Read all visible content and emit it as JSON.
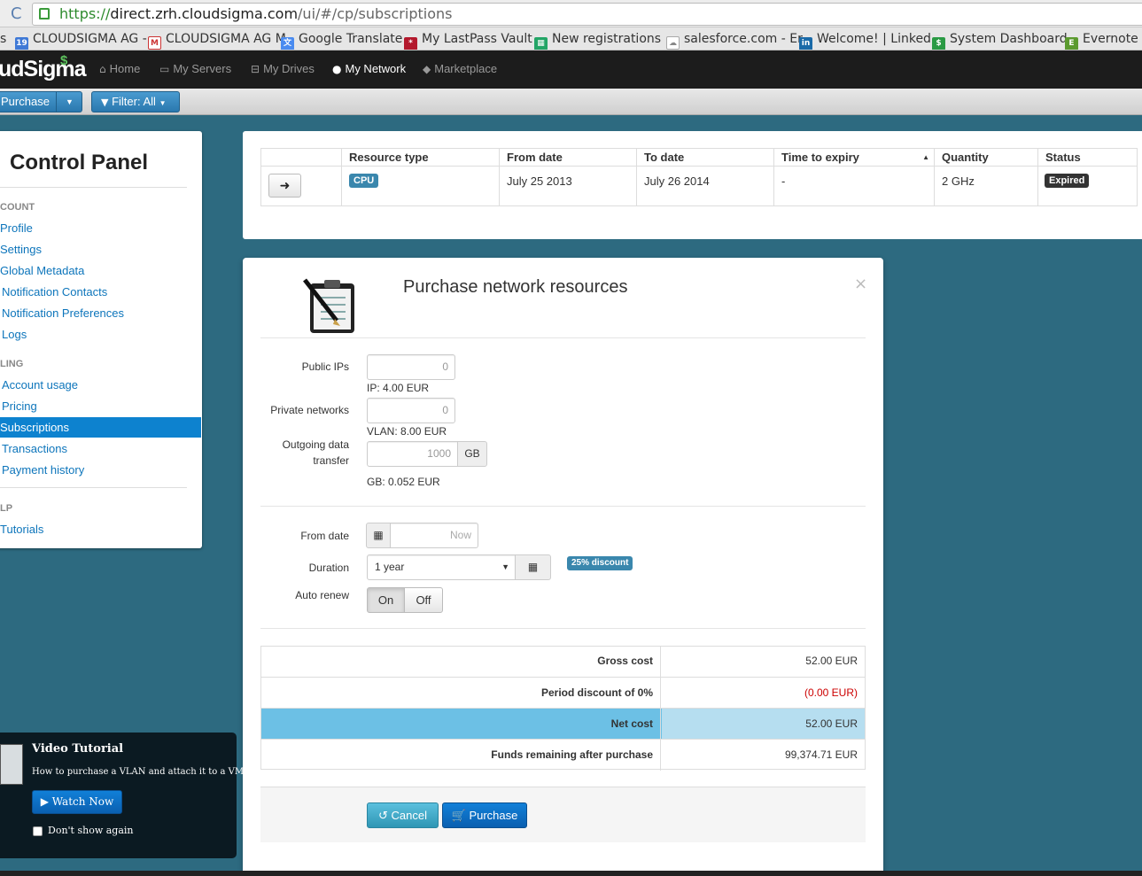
{
  "browser": {
    "url_scheme": "https://",
    "url_host": "direct.zrh.cloudsigma.com",
    "url_path": "/ui/#/cp/subscriptions",
    "bookmarks": [
      {
        "label": "s",
        "icon": "none"
      },
      {
        "label": "CLOUDSIGMA AG -",
        "icon": "calendar-icon"
      },
      {
        "label": "CLOUDSIGMA AG M",
        "icon": "gmail-icon"
      },
      {
        "label": "Google Translate",
        "icon": "translate-icon"
      },
      {
        "label": "My LastPass Vault",
        "icon": "lastpass-icon"
      },
      {
        "label": "New registrations",
        "icon": "sheets-icon"
      },
      {
        "label": "salesforce.com - Er",
        "icon": "cloud-icon"
      },
      {
        "label": "Welcome! | Linked",
        "icon": "linkedin-icon"
      },
      {
        "label": "System Dashboard",
        "icon": "dashboard-icon"
      },
      {
        "label": "Evernote W",
        "icon": "evernote-icon"
      }
    ]
  },
  "app": {
    "logo_text": "udSigma",
    "logo_mark": "$",
    "nav": [
      {
        "label": "Home",
        "icon": "home-icon"
      },
      {
        "label": "My Servers",
        "icon": "monitor-icon"
      },
      {
        "label": "My Drives",
        "icon": "drive-icon"
      },
      {
        "label": "My Network",
        "icon": "globe-icon"
      },
      {
        "label": "Marketplace",
        "icon": "tag-icon"
      }
    ],
    "toolbar": {
      "purchase_label": "Purchase",
      "filter_label": "Filter: All"
    }
  },
  "sidebar": {
    "title": "Control Panel",
    "section_account": "COUNT",
    "account_links": [
      "Profile",
      "Settings",
      "Global Metadata",
      "Notification Contacts",
      "Notification Preferences",
      "Logs"
    ],
    "section_billing": "LING",
    "billing_links": [
      "Account usage",
      "Pricing",
      "Subscriptions",
      "Transactions",
      "Payment history"
    ],
    "section_help": "LP",
    "help_links": [
      "Tutorials"
    ]
  },
  "subscriptions": {
    "columns": [
      "Resource type",
      "From date",
      "To date",
      "Time to expiry",
      "Quantity",
      "Status"
    ],
    "rows": [
      {
        "resource_type": "CPU",
        "from_date": "July 25 2013",
        "to_date": "July 26 2014",
        "time_to_expiry": "-",
        "quantity": "2 GHz",
        "status": "Expired"
      }
    ]
  },
  "modal": {
    "title": "Purchase network resources",
    "close": "×",
    "public_ips_label": "Public IPs",
    "public_ips_value": "0",
    "public_ips_help": "IP: 4.00 EUR",
    "private_networks_label": "Private networks",
    "private_networks_value": "0",
    "private_networks_help": "VLAN: 8.00 EUR",
    "outgoing_label_1": "Outgoing data",
    "outgoing_label_2": "transfer",
    "outgoing_value": "1000",
    "outgoing_unit": "GB",
    "outgoing_help": "GB: 0.052 EUR",
    "from_date_label": "From date",
    "from_date_placeholder": "Now",
    "duration_label": "Duration",
    "duration_value": "1 year",
    "discount_badge": "25% discount",
    "auto_renew_label": "Auto renew",
    "auto_renew_on": "On",
    "auto_renew_off": "Off",
    "costs": [
      {
        "label": "Gross cost",
        "value": "52.00 EUR"
      },
      {
        "label": "Period discount of 0%",
        "value": "(0.00 EUR)"
      },
      {
        "label": "Net cost",
        "value": "52.00 EUR"
      },
      {
        "label": "Funds remaining after purchase",
        "value": "99,374.71 EUR"
      }
    ],
    "cancel_label": "Cancel",
    "purchase_label": "Purchase"
  },
  "video_tutorial": {
    "title": "Video Tutorial",
    "description": "How to purchase a VLAN and attach it to a VM",
    "watch_label": "Watch Now",
    "dont_show_label": "Don't show again"
  },
  "colors": {
    "background": "#2d6a80",
    "accent": "#0d82cf",
    "net_cost_row": "#6cc0e5",
    "discount_red": "#cc0000",
    "expired_badge": "#333333",
    "cpu_badge": "#3a87ad"
  }
}
